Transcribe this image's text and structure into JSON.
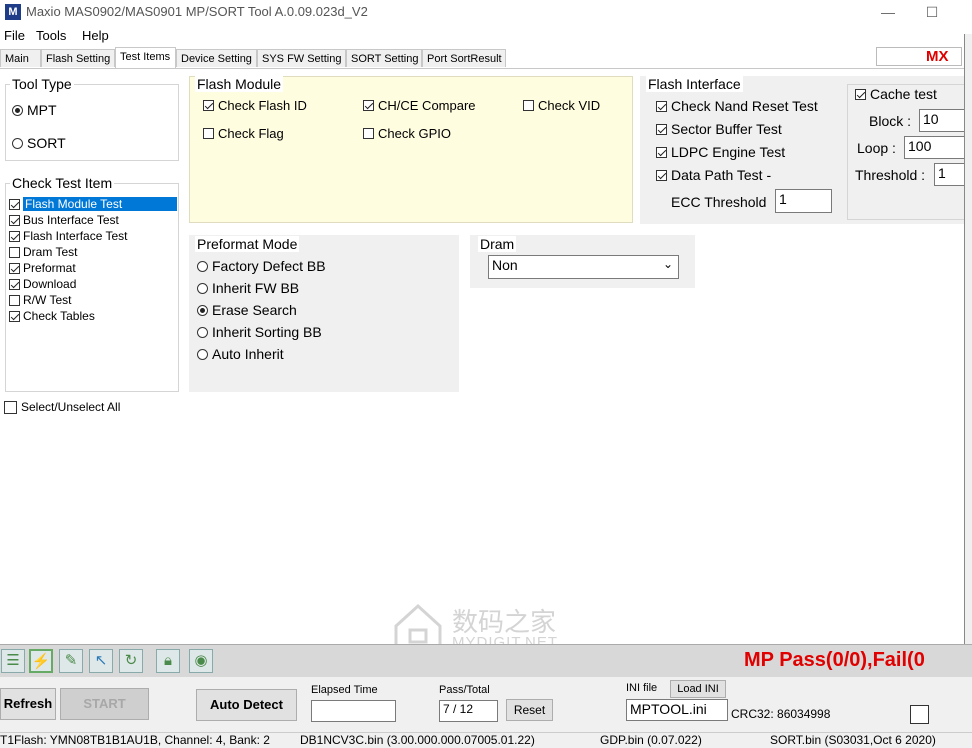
{
  "window": {
    "title": "Maxio MAS0902/MAS0901 MP/SORT Tool A.0.09.023d_V2",
    "icon_letter": "M"
  },
  "menu": [
    "File",
    "Tools",
    "Help"
  ],
  "tabs": [
    "Main",
    "Flash Setting",
    "Test Items",
    "Device Setting",
    "SYS FW Setting",
    "SORT Setting",
    "Port SortResult"
  ],
  "active_tab": "Test Items",
  "brand": "MX",
  "tool_type": {
    "title": "Tool Type",
    "options": [
      "MPT",
      "SORT"
    ],
    "selected": "MPT"
  },
  "check_test_item": {
    "title": "Check Test Item",
    "items": [
      {
        "label": "Flash Module Test",
        "checked": true,
        "selected": true
      },
      {
        "label": "Bus Interface Test",
        "checked": true
      },
      {
        "label": "Flash Interface Test",
        "checked": true
      },
      {
        "label": "Dram Test",
        "checked": false
      },
      {
        "label": "Preformat",
        "checked": true
      },
      {
        "label": "Download",
        "checked": true
      },
      {
        "label": "R/W Test",
        "checked": false
      },
      {
        "label": "Check Tables",
        "checked": true
      }
    ],
    "select_all": "Select/Unselect All"
  },
  "flash_module": {
    "title": "Flash Module",
    "check_flash_id": "Check Flash ID",
    "chce_compare": "CH/CE Compare",
    "check_vid": "Check VID",
    "check_flag": "Check Flag",
    "check_gpio": "Check GPIO"
  },
  "flash_interface": {
    "title": "Flash Interface",
    "nand_reset": "Check Nand Reset Test",
    "sector_buffer": "Sector Buffer Test",
    "ldpc": "LDPC Engine Test",
    "data_path": "Data Path Test -",
    "ecc_label": "ECC Threshold",
    "ecc_value": "1",
    "cache_test": "Cache test",
    "block_label": "Block :",
    "block_value": "10",
    "loop_label": "Loop :",
    "loop_value": "100",
    "threshold_label": "Threshold :",
    "threshold_value": "1"
  },
  "preformat": {
    "title": "Preformat Mode",
    "options": [
      "Factory Defect BB",
      "Inherit FW BB",
      "Erase Search",
      "Inherit Sorting BB",
      "Auto Inherit"
    ],
    "selected": "Erase Search"
  },
  "dram": {
    "title": "Dram",
    "value": "Non"
  },
  "status_mp": "MP  Pass(0/0),Fail(0",
  "controls": {
    "refresh": "Refresh",
    "start": "START",
    "auto_detect": "Auto Detect",
    "elapsed_label": "Elapsed Time",
    "elapsed_value": "",
    "pass_total_label": "Pass/Total",
    "pass_total_value": "7 / 12",
    "reset": "Reset",
    "ini_label": "INI file",
    "load_ini": "Load INI",
    "ini_value": "MPTOOL.ini",
    "crc": "CRC32: 86034998"
  },
  "statusbar": [
    "T1Flash: YMN08TB1B1AU1B, Channel: 4, Bank: 2",
    "DB1NCV3C.bin (3.00.000.000.07005.01.22)",
    "GDP.bin (0.07.022)",
    "SORT.bin (S03031,Oct  6 2020)"
  ],
  "watermark": {
    "cn": "数码之家",
    "en": "MYDIGIT.NET"
  },
  "colors": {
    "accent": "#0078d7",
    "status_red": "#e00000",
    "flash_module_bg": "#fffde0"
  }
}
